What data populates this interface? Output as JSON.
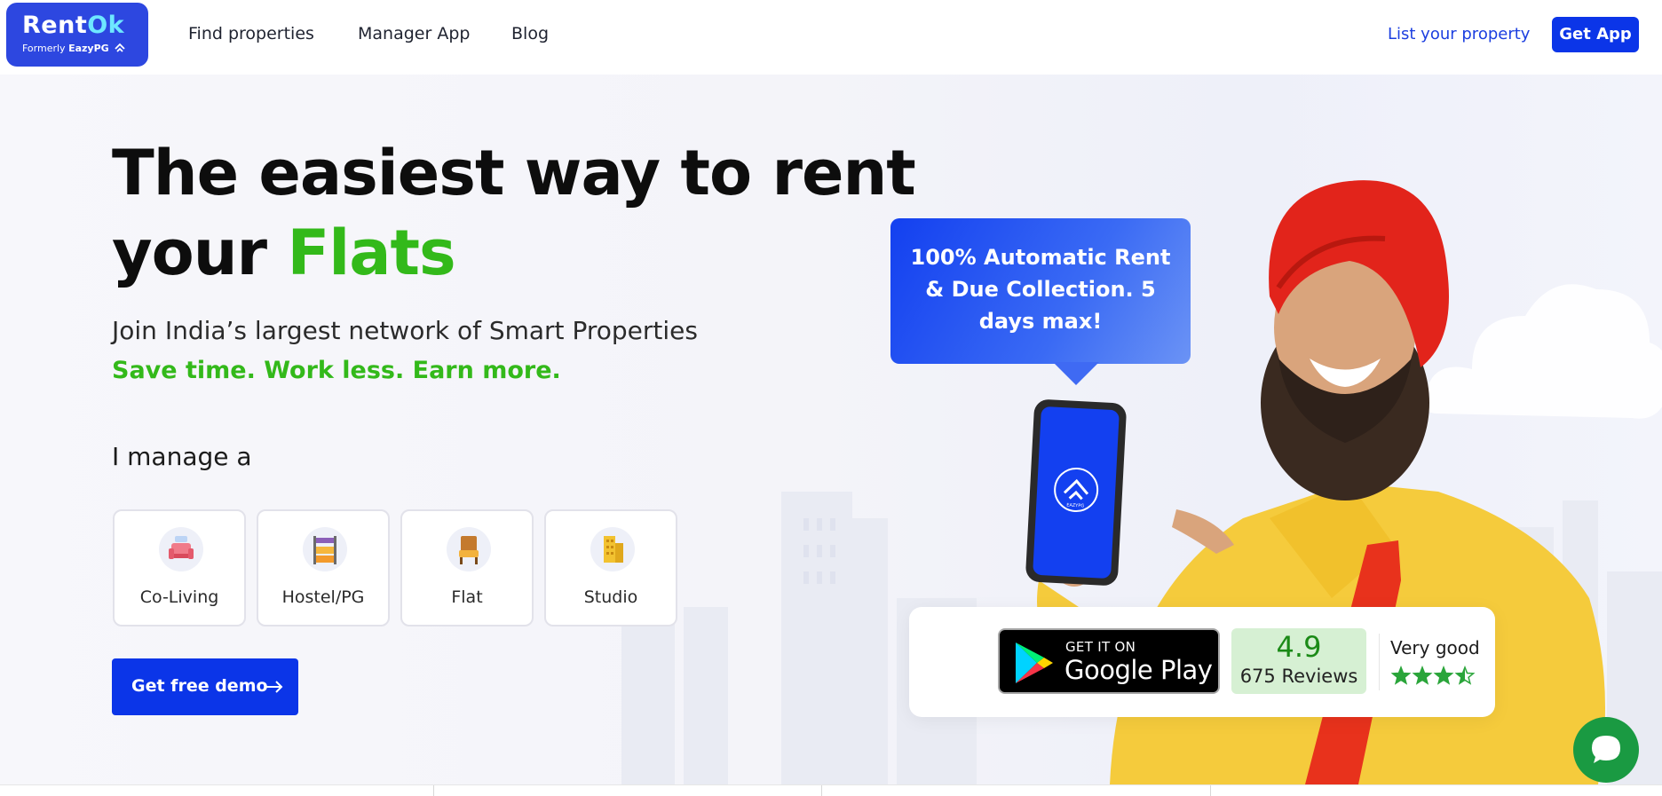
{
  "brand": {
    "name_part1": "Rent",
    "name_part2": "Ok",
    "formerly_prefix": "Formerly",
    "formerly_name": "EazyPG"
  },
  "nav": {
    "links": [
      "Find properties",
      "Manager App",
      "Blog"
    ],
    "list_property": "List your property",
    "get_app": "Get App"
  },
  "hero": {
    "title_line1": "The easiest way to rent",
    "title_line2_prefix": "your ",
    "title_line2_accent": "Flats",
    "subtitle": "Join India’s largest network of Smart Properties",
    "tagline": "Save time. Work less. Earn more.",
    "manage_label": "I manage a",
    "property_types": [
      {
        "label": "Co-Living",
        "icon": "sofa-icon"
      },
      {
        "label": "Hostel/PG",
        "icon": "bunk-bed-icon"
      },
      {
        "label": "Flat",
        "icon": "chair-icon"
      },
      {
        "label": "Studio",
        "icon": "building-icon"
      }
    ],
    "demo_button": "Get free demo"
  },
  "promo": {
    "bubble_text": "100% Automatic Rent & Due Collection. 5 days max!",
    "phone_logo_text": "EAZYPG"
  },
  "rating": {
    "store_small": "GET IT ON",
    "store_big": "Google Play",
    "score": "4.9",
    "reviews": "675 Reviews",
    "verdict": "Very good",
    "stars": 3.5
  },
  "colors": {
    "primary": "#0b35e8",
    "accent_green": "#33b91a",
    "logo_bg": "#2d47e0",
    "chat_green": "#1a9a42"
  }
}
